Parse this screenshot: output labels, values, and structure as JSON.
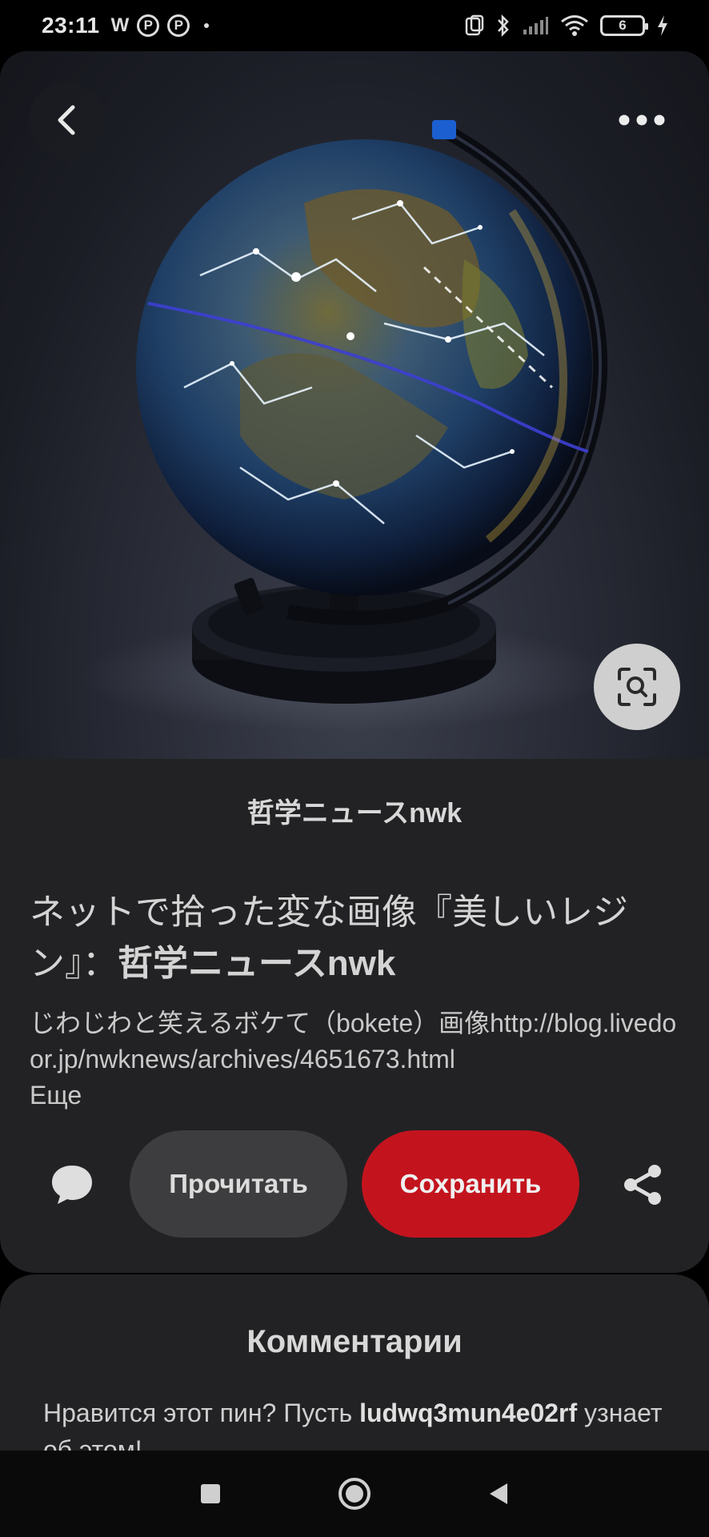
{
  "status_bar": {
    "time": "23:11",
    "app_icons": [
      "w-app-icon",
      "pinterest-icon",
      "pinterest-icon"
    ],
    "battery_level": "6",
    "icons": [
      "nfc-icon",
      "bluetooth-icon",
      "signal-icon",
      "wifi-icon",
      "battery-icon",
      "charging-icon"
    ]
  },
  "pin": {
    "source": "哲学ニュースnwk",
    "title_part": "ネットで拾った変な画像『美しいレジン』：",
    "title_strong": "哲学ニュースnwk",
    "description": "じわじわと笑えるボケて（bokete）画像http://blog.livedoor.jp/nwknews/archives/4651673.html",
    "more_label": "Еще"
  },
  "actions": {
    "read_label": "Прочитать",
    "save_label": "Сохранить"
  },
  "comments": {
    "title": "Комментарии",
    "prompt_prefix": "Нравится этот пин? Пусть ",
    "username": "ludwq3mun4e02rf",
    "prompt_suffix": " узнает об этом!"
  },
  "colors": {
    "save_button": "#c3141e",
    "card_background": "#222224",
    "read_button": "#3d3d3f"
  }
}
